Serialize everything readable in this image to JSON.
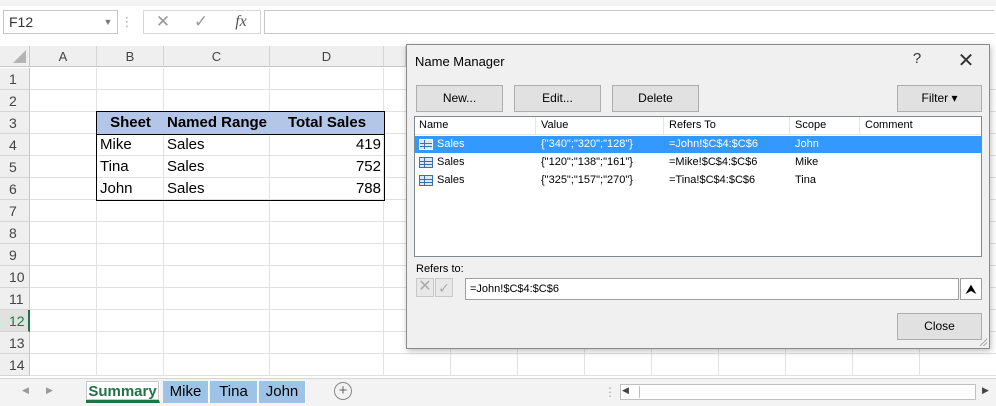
{
  "formula_bar": {
    "name_box": "F12",
    "cancel_glyph": "✕",
    "enter_glyph": "✓",
    "fx_label": "fx",
    "formula": ""
  },
  "columns": [
    "A",
    "B",
    "C",
    "D"
  ],
  "rows": [
    "1",
    "2",
    "3",
    "4",
    "5",
    "6",
    "7",
    "8",
    "9",
    "10",
    "11",
    "12",
    "13",
    "14"
  ],
  "selected_row": "12",
  "table": {
    "headers": [
      "Sheet",
      "Named Range",
      "Total Sales"
    ],
    "header_fill": "#b4c6e7",
    "rows": [
      {
        "sheet": "Mike",
        "range": "Sales",
        "total": "419"
      },
      {
        "sheet": "Tina",
        "range": "Sales",
        "total": "752"
      },
      {
        "sheet": "John",
        "range": "Sales",
        "total": "788"
      }
    ]
  },
  "sheet_tabs": {
    "active": "Summary",
    "tabs": [
      "Summary",
      "Mike",
      "Tina",
      "John"
    ],
    "add_label": "+"
  },
  "dialog": {
    "title": "Name Manager",
    "help": "?",
    "close": "✕",
    "buttons": {
      "new": "New...",
      "edit": "Edit...",
      "delete": "Delete",
      "filter": "Filter ▾"
    },
    "columns": [
      "Name",
      "Value",
      "Refers To",
      "Scope",
      "Comment"
    ],
    "names": [
      {
        "name": "Sales",
        "value": "{\"340\";\"320\";\"128\"}",
        "refers_to": "=John!$C$4:$C$6",
        "scope": "John",
        "comment": "",
        "selected": true
      },
      {
        "name": "Sales",
        "value": "{\"120\";\"138\";\"161\"}",
        "refers_to": "=Mike!$C$4:$C$6",
        "scope": "Mike",
        "comment": "",
        "selected": false
      },
      {
        "name": "Sales",
        "value": "{\"325\";\"157\";\"270\"}",
        "refers_to": "=Tina!$C$4:$C$6",
        "scope": "Tina",
        "comment": "",
        "selected": false
      }
    ],
    "refers_to_label": "Refers to:",
    "refers_to_value": "=John!$C$4:$C$6",
    "close_button": "Close",
    "selection_color": "#3399ff"
  }
}
